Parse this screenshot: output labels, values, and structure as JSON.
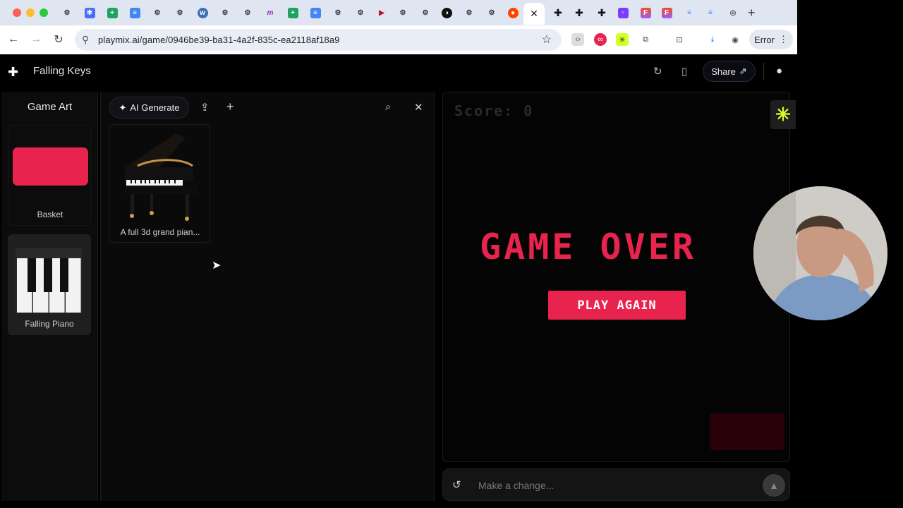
{
  "browser": {
    "url": "playmix.ai/game/0946be39-ba31-4a2f-835c-ea2118af18a9",
    "error_label": "Error"
  },
  "header": {
    "title": "Falling Keys",
    "share_label": "Share"
  },
  "sidebar": {
    "title": "Game Art",
    "items": [
      {
        "label": "Basket",
        "color": "#e8234e"
      },
      {
        "label": "Falling Piano"
      }
    ]
  },
  "art_panel": {
    "ai_generate_label": "AI Generate",
    "items": [
      {
        "caption": "A full 3d grand pian..."
      }
    ]
  },
  "game": {
    "score_text": "Score: 0",
    "game_over_text": "GAME OVER",
    "play_again_label": "PLAY AGAIN",
    "accent_color": "#e8234e"
  },
  "prompt": {
    "placeholder": "Make a change..."
  }
}
